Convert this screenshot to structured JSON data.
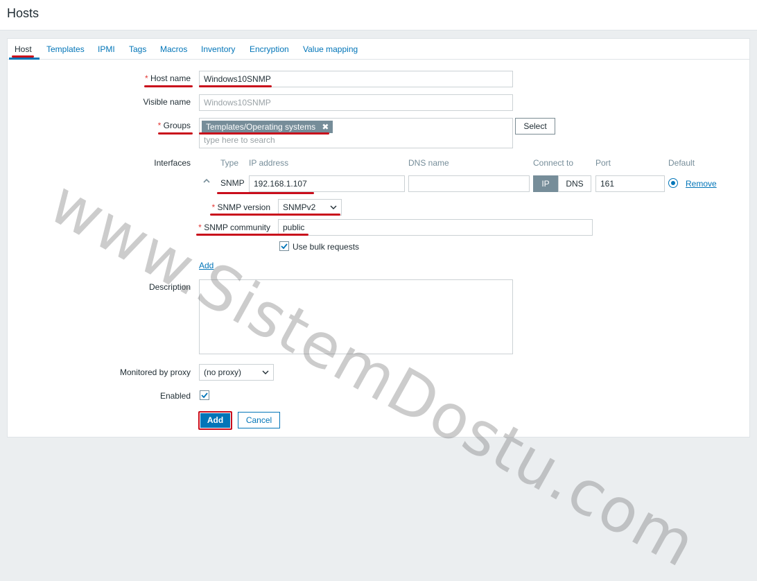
{
  "page": {
    "title": "Hosts"
  },
  "tabs": [
    "Host",
    "Templates",
    "IPMI",
    "Tags",
    "Macros",
    "Inventory",
    "Encryption",
    "Value mapping"
  ],
  "form": {
    "host_name": {
      "label": "Host name",
      "value": "Windows10SNMP"
    },
    "visible_name": {
      "label": "Visible name",
      "placeholder": "Windows10SNMP"
    },
    "groups": {
      "label": "Groups",
      "tag": "Templates/Operating systems",
      "tag_remove": "✖",
      "placeholder": "type here to search",
      "select_label": "Select"
    },
    "interfaces": {
      "label": "Interfaces",
      "headers": {
        "type": "Type",
        "ip": "IP address",
        "dns": "DNS name",
        "connect_to": "Connect to",
        "port": "Port",
        "default": "Default"
      },
      "row": {
        "type": "SNMP",
        "ip": "192.168.1.107",
        "dns": "",
        "connect_ip": "IP",
        "connect_dns": "DNS",
        "port": "161",
        "remove": "Remove"
      },
      "snmp_version": {
        "label": "SNMP version",
        "value": "SNMPv2"
      },
      "snmp_community": {
        "label": "SNMP community",
        "value": "public"
      },
      "bulk": {
        "label": "Use bulk requests",
        "checked": true
      },
      "add": "Add"
    },
    "description": {
      "label": "Description",
      "value": ""
    },
    "proxy": {
      "label": "Monitored by proxy",
      "value": "(no proxy)"
    },
    "enabled": {
      "label": "Enabled",
      "checked": true
    },
    "buttons": {
      "add": "Add",
      "cancel": "Cancel"
    }
  },
  "watermark": "www.SistemDostu.com",
  "colors": {
    "accent": "#0275b8",
    "highlight": "#c90d1b",
    "required": "#e33734"
  }
}
